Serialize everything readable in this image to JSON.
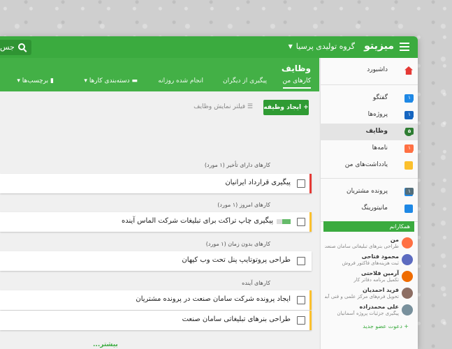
{
  "topbar": {
    "brand": "میزیتو",
    "org": "گروه تولیدی پرسیا",
    "search_label": "جس"
  },
  "sidebar": {
    "items": [
      {
        "label": "داشبورد",
        "icon": "home-icon",
        "color": "#e53935"
      },
      {
        "label": "گفتگو",
        "icon": "chat-icon",
        "color": "#1e88e5",
        "badge": "۱",
        "badge_color": "#1e88e5"
      },
      {
        "label": "پروژه‌ها",
        "icon": "list-icon",
        "color": "#1565c0",
        "badge": "۱",
        "badge_color": "#1565c0"
      },
      {
        "label": "وظایف",
        "icon": "check-circle-icon",
        "color": "#2e7d32",
        "badge": "۵",
        "badge_color": "#2e7d32"
      },
      {
        "label": "نامه‌ها",
        "icon": "mail-icon",
        "color": "#ff7043",
        "badge": "۱",
        "badge_color": "#ff7043"
      },
      {
        "label": "یادداشت‌های من",
        "icon": "note-icon",
        "color": "#fbc02d"
      },
      {
        "label": "پرونده مشتریان",
        "icon": "contact-icon",
        "color": "#1e88e5",
        "badge": "۱",
        "badge_color": "#546e7a"
      },
      {
        "label": "مانیتورینگ",
        "icon": "bar-chart-icon",
        "color": "#1e88e5"
      }
    ],
    "colleagues_title": "همکارانم",
    "colleagues": [
      {
        "name": "من",
        "status": "طراحی بنرهای تبلیغاتی سامان صنعت...",
        "avatar_color": "#ff7043"
      },
      {
        "name": "محمود فتاحی",
        "status": "ثبت هزینه‌های فاکتور فروش",
        "avatar_color": "#5c6bc0"
      },
      {
        "name": "آرمین فلاحتی",
        "status": "تکمیل برنامه دفاتر کار",
        "avatar_color": "#ef6c00"
      },
      {
        "name": "فرید احمدیان",
        "status": "تحویل فرم‌های مرکز علمی و فنی آبشی...",
        "avatar_color": "#8d6e63"
      },
      {
        "name": "علی محمدزاده",
        "status": "پیگیری جزئیات پروژه آسمانیان",
        "avatar_color": "#78909c"
      }
    ],
    "invite": "+ دعوت عضو جدید"
  },
  "main": {
    "title": "وظایف",
    "tabs": [
      "کارهای من",
      "پیگیری از دیگران",
      "انجام شده روزانه"
    ],
    "category_filter": "دسته‌بندی کارها",
    "tags_filter": "برچسب‌ها",
    "create_button": "+  ایجاد وظیفه",
    "filter_label": "فیلتر نمایش وظایف",
    "groups": [
      {
        "label": "کارهای دارای تأخیر (۱ مورد)",
        "tasks": [
          {
            "text": "پیگیری قرارداد ایرانیان",
            "stripe": "#e53935"
          }
        ]
      },
      {
        "label": "کارهای امروز (۱ مورد)",
        "tasks": [
          {
            "text": "پیگیری چاپ تراکت برای تبلیغات شرکت الماس آینده",
            "stripe": "#fbc02d",
            "progress": 0.6
          }
        ]
      },
      {
        "label": "کارهای بدون زمان (۱ مورد)",
        "tasks": [
          {
            "text": "طراحی پروتوتایپ پنل تحت وب کیهان",
            "stripe": ""
          }
        ]
      },
      {
        "label": "کارهای آینده",
        "tasks": [
          {
            "text": "ایجاد پرونده شرکت سامان صنعت در پرونده مشتریان",
            "stripe": "#fbc02d"
          },
          {
            "text": "طراحی بنرهای تبلیغاتی سامان صنعت",
            "stripe": "#fbc02d"
          }
        ]
      }
    ],
    "more": "...بیشتر"
  }
}
